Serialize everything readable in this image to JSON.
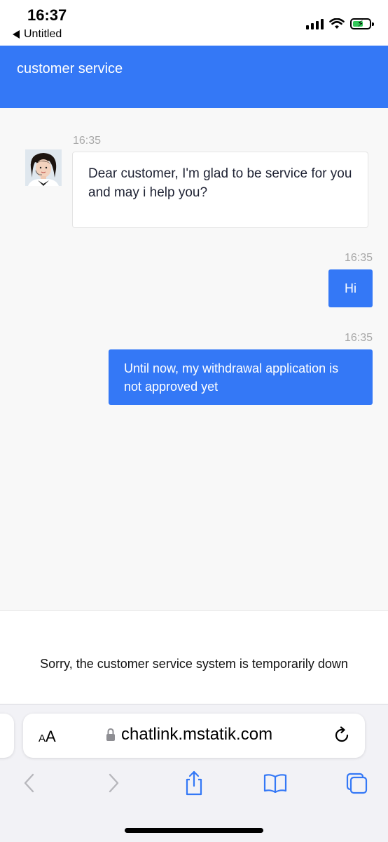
{
  "status_bar": {
    "time": "16:37",
    "back_label": "Untitled",
    "icons": [
      "signal-icon",
      "wifi-icon",
      "battery-charging-icon"
    ],
    "battery_level": 0.5
  },
  "header": {
    "title": "customer service"
  },
  "messages": [
    {
      "direction": "incoming",
      "time": "16:35",
      "text": "Dear customer, I'm glad to be service for you and may i help you?"
    },
    {
      "direction": "outgoing",
      "time": "16:35",
      "text": "Hi"
    },
    {
      "direction": "outgoing",
      "time": "16:35",
      "text": "Until now, my withdrawal application is not approved yet"
    }
  ],
  "notice": {
    "text": "Sorry, the customer service system is temporarily down"
  },
  "browser": {
    "text_size_button": "AA",
    "url": "chatlink.mstatik.com",
    "icons": [
      "lock-icon",
      "reload-icon",
      "back-arrow-icon",
      "forward-arrow-icon",
      "share-icon",
      "bookmarks-icon",
      "tabs-icon"
    ]
  },
  "colors": {
    "accent": "#3478f6",
    "timestamp": "#a8a8a8",
    "background": "#f8f8f8"
  }
}
